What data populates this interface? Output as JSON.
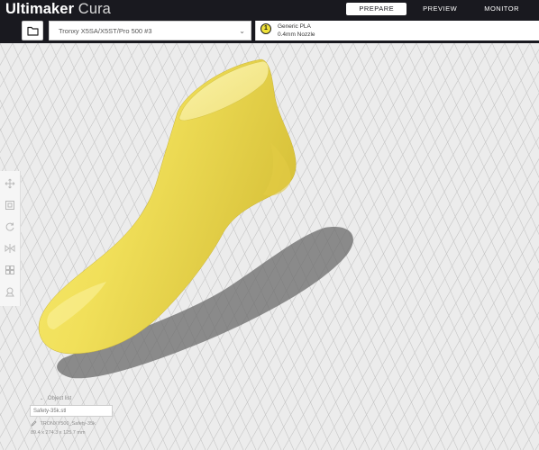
{
  "app": {
    "name_bold": "Ultimaker",
    "name_light": "Cura"
  },
  "nav": {
    "tabs": [
      {
        "label": "PREPARE",
        "active": true
      },
      {
        "label": "PREVIEW",
        "active": false
      },
      {
        "label": "MONITOR",
        "active": false
      }
    ]
  },
  "printer": {
    "selected": "Tronxy X5SA/X5ST/Pro 500 #3"
  },
  "material": {
    "extruder_number": "1",
    "name": "Generic PLA",
    "nozzle": "0.4mm Nozzle"
  },
  "icons": {
    "open": "folder-icon",
    "dropdown": "chevron-down-icon",
    "tools": [
      "move-icon",
      "scale-icon",
      "rotate-icon",
      "mirror-icon",
      "per-model-settings-icon",
      "support-blocker-icon"
    ]
  },
  "object_list": {
    "header": "Object list",
    "object_name": "Safety-35k.stl",
    "printer_line": "TRONXY500_Safety-35k",
    "dimensions": "89.4 x 274.3 x 125.7 mm"
  },
  "colors": {
    "topbar": "#19191f",
    "model": "#f5e96a",
    "build_plate": "#ececec",
    "grid": "#c8c8c8"
  }
}
